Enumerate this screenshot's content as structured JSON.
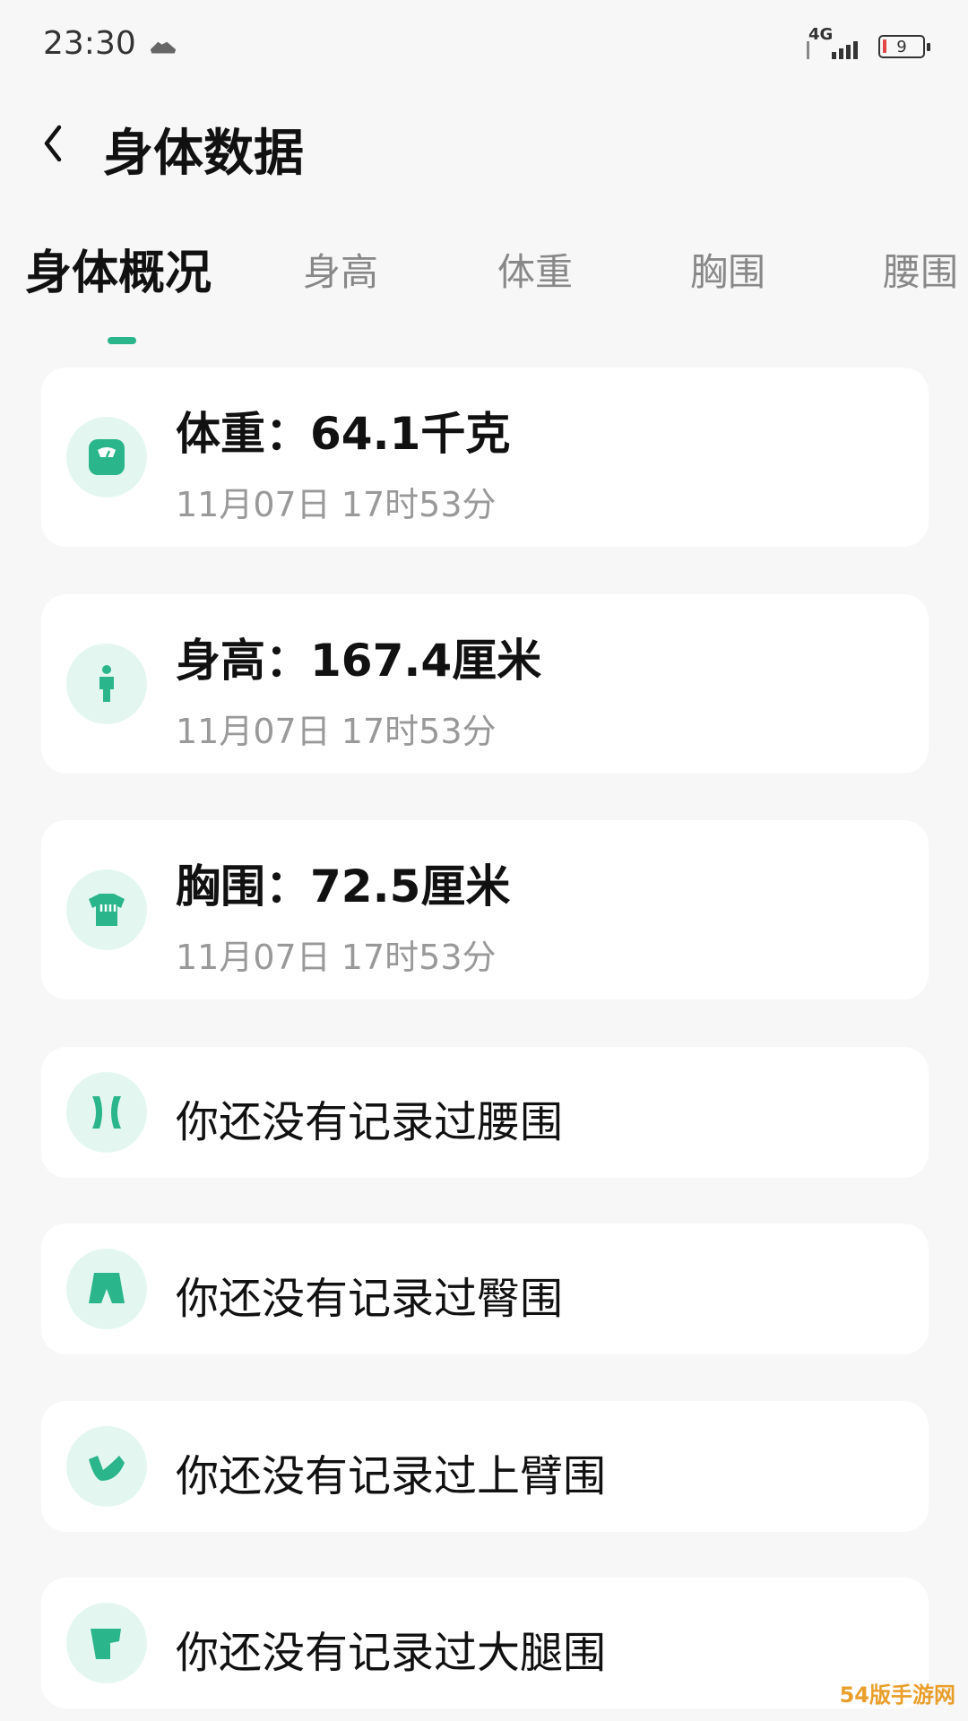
{
  "status_bar": {
    "time": "23:30",
    "network": "4G",
    "battery": "9"
  },
  "header": {
    "title": "身体数据"
  },
  "tabs": [
    {
      "label": "身体概况",
      "active": true
    },
    {
      "label": "身高",
      "active": false
    },
    {
      "label": "体重",
      "active": false
    },
    {
      "label": "胸围",
      "active": false
    },
    {
      "label": "腰围",
      "active": false
    }
  ],
  "records": [
    {
      "icon": "scale-icon",
      "title": "体重：64.1千克",
      "time": "11月07日 17时53分"
    },
    {
      "icon": "person-icon",
      "title": "身高：167.4厘米",
      "time": "11月07日 17时53分"
    },
    {
      "icon": "shirt-icon",
      "title": "胸围：72.5厘米",
      "time": "11月07日 17时53分"
    }
  ],
  "empty_records": [
    {
      "icon": "waist-icon",
      "text": "你还没有记录过腰围"
    },
    {
      "icon": "shorts-icon",
      "text": "你还没有记录过臀围"
    },
    {
      "icon": "arm-icon",
      "text": "你还没有记录过上臂围"
    },
    {
      "icon": "thigh-icon",
      "text": "你还没有记录过大腿围"
    }
  ],
  "watermark": "54版手游网",
  "colors": {
    "accent": "#2bb58a",
    "icon_bg": "#e3f7f0",
    "background": "#f7f7f7"
  }
}
